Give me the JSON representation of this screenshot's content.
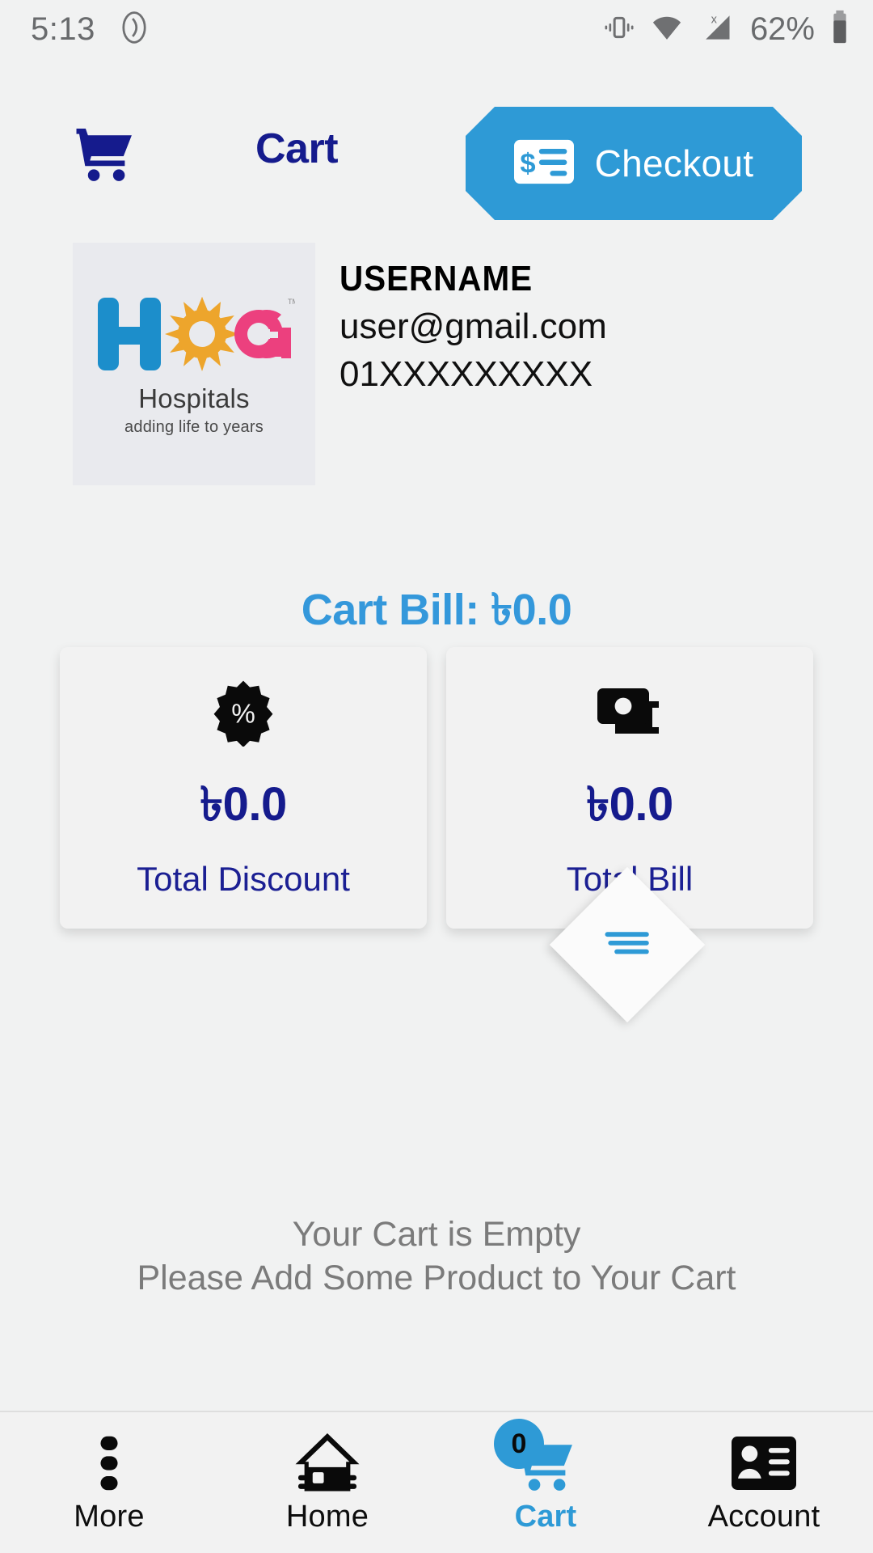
{
  "status_bar": {
    "time": "5:13",
    "battery_percent": "62%",
    "icons": [
      "play-circle-icon",
      "vibrate-icon",
      "wifi-icon",
      "cellular-signal-no-sim-icon",
      "battery-icon"
    ]
  },
  "header": {
    "title": "Cart",
    "cart_icon": "shopping-cart-icon",
    "checkout": {
      "label": "Checkout",
      "icon": "cheque-dollar-icon",
      "color": "#2e9ad6"
    }
  },
  "profile": {
    "logo": {
      "letters": "HCG",
      "name": "Hospitals",
      "tagline": "adding life to years",
      "colors": {
        "h": "#1c8ecb",
        "c": "#eda52c",
        "g": "#ec407e"
      }
    },
    "username": "USERNAME",
    "email": "user@gmail.com",
    "phone": "01XXXXXXXXX"
  },
  "summary": {
    "cart_bill_label": "Cart Bill: ৳0.0",
    "cards": [
      {
        "icon": "discount-percent-badge-icon",
        "value": "৳0.0",
        "label": "Total Discount"
      },
      {
        "icon": "banknote-money-icon",
        "value": "৳0.0",
        "label": "Total Bill"
      }
    ],
    "accent_color": "#3498db",
    "value_color": "#151b8d"
  },
  "fab": {
    "icon": "menu-lines-icon"
  },
  "empty_state": {
    "line1": "Your Cart is Empty",
    "line2": "Please Add Some Product to Your Cart"
  },
  "bottom_nav": {
    "items": [
      {
        "label": "More",
        "icon": "three-dots-vertical-icon",
        "active": false
      },
      {
        "label": "Home",
        "icon": "home-icon",
        "active": false
      },
      {
        "label": "Cart",
        "icon": "shopping-cart-icon",
        "active": true,
        "badge": "0"
      },
      {
        "label": "Account",
        "icon": "id-card-icon",
        "active": false
      }
    ],
    "active_color": "#2e9ad6"
  }
}
